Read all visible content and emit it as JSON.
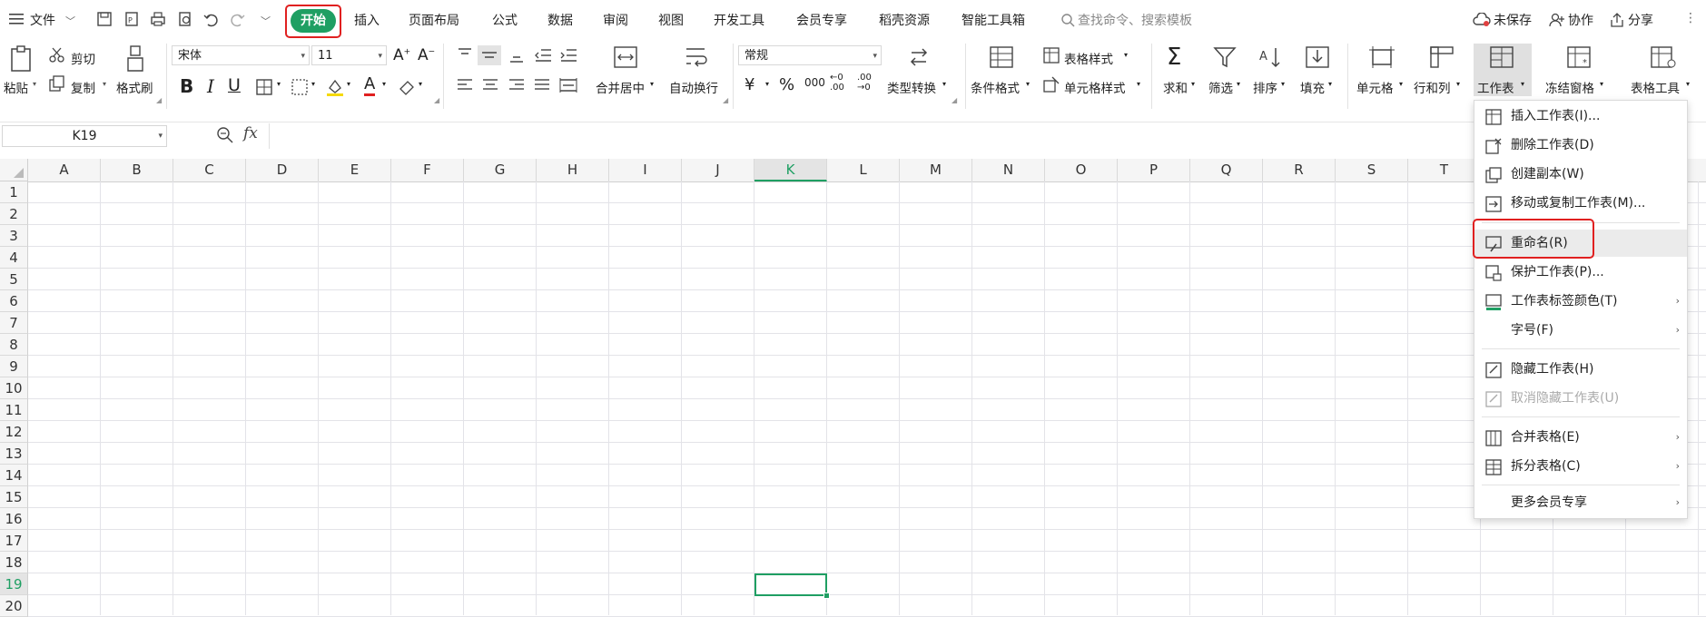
{
  "menubar": {
    "file": "文件",
    "tabs": [
      "开始",
      "插入",
      "页面布局",
      "公式",
      "数据",
      "审阅",
      "视图",
      "开发工具",
      "会员专享",
      "稻壳资源",
      "智能工具箱"
    ],
    "search_placeholder": "查找命令、搜索模板",
    "unsaved": "未保存",
    "collab": "协作",
    "share": "分享"
  },
  "ribbon": {
    "paste": "粘贴",
    "cut": "剪切",
    "copy": "复制",
    "format_painter": "格式刷",
    "font_name": "宋体",
    "font_size": "11",
    "merge_center": "合并居中",
    "wrap_text": "自动换行",
    "number_format": "常规",
    "convert_type": "类型转换",
    "cond_format": "条件格式",
    "table_style": "表格样式",
    "cell_style": "单元格样式",
    "sum": "求和",
    "filter": "筛选",
    "sort": "排序",
    "fill": "填充",
    "cell": "单元格",
    "row_col": "行和列",
    "worksheet": "工作表",
    "freeze": "冻结窗格",
    "table_tools": "表格工具",
    "currency": "¥",
    "percent": "%",
    "thousands": "000"
  },
  "formula_bar": {
    "cell_ref": "K19",
    "fx": "fx"
  },
  "grid": {
    "columns": [
      "A",
      "B",
      "C",
      "D",
      "E",
      "F",
      "G",
      "H",
      "I",
      "J",
      "K",
      "L",
      "M",
      "N",
      "O",
      "P",
      "Q",
      "R",
      "S",
      "T"
    ],
    "rows": [
      "1",
      "2",
      "3",
      "4",
      "5",
      "6",
      "7",
      "8",
      "9",
      "10",
      "11",
      "12",
      "13",
      "14",
      "15",
      "16",
      "17",
      "18",
      "19",
      "20"
    ],
    "selected_cell": "K19"
  },
  "dropdown": {
    "items": [
      {
        "label": "插入工作表(I)...",
        "icon": "insert-sheet-icon"
      },
      {
        "label": "删除工作表(D)",
        "icon": "delete-sheet-icon"
      },
      {
        "label": "创建副本(W)",
        "icon": "copy-sheet-icon"
      },
      {
        "label": "移动或复制工作表(M)...",
        "icon": "move-sheet-icon"
      },
      {
        "label": "重命名(R)",
        "icon": "rename-icon"
      },
      {
        "label": "保护工作表(P)...",
        "icon": "protect-sheet-icon"
      },
      {
        "label": "工作表标签颜色(T)",
        "icon": "tab-color-icon"
      },
      {
        "label": "字号(F)",
        "icon": ""
      },
      {
        "label": "隐藏工作表(H)",
        "icon": "hide-sheet-icon"
      },
      {
        "label": "取消隐藏工作表(U)",
        "icon": "unhide-sheet-icon"
      },
      {
        "label": "合并表格(E)",
        "icon": "merge-table-icon"
      },
      {
        "label": "拆分表格(C)",
        "icon": "split-table-icon"
      },
      {
        "label": "更多会员专享",
        "icon": ""
      }
    ]
  },
  "colors": {
    "accent_green": "#1f9f63",
    "highlight_red": "#e02020"
  }
}
